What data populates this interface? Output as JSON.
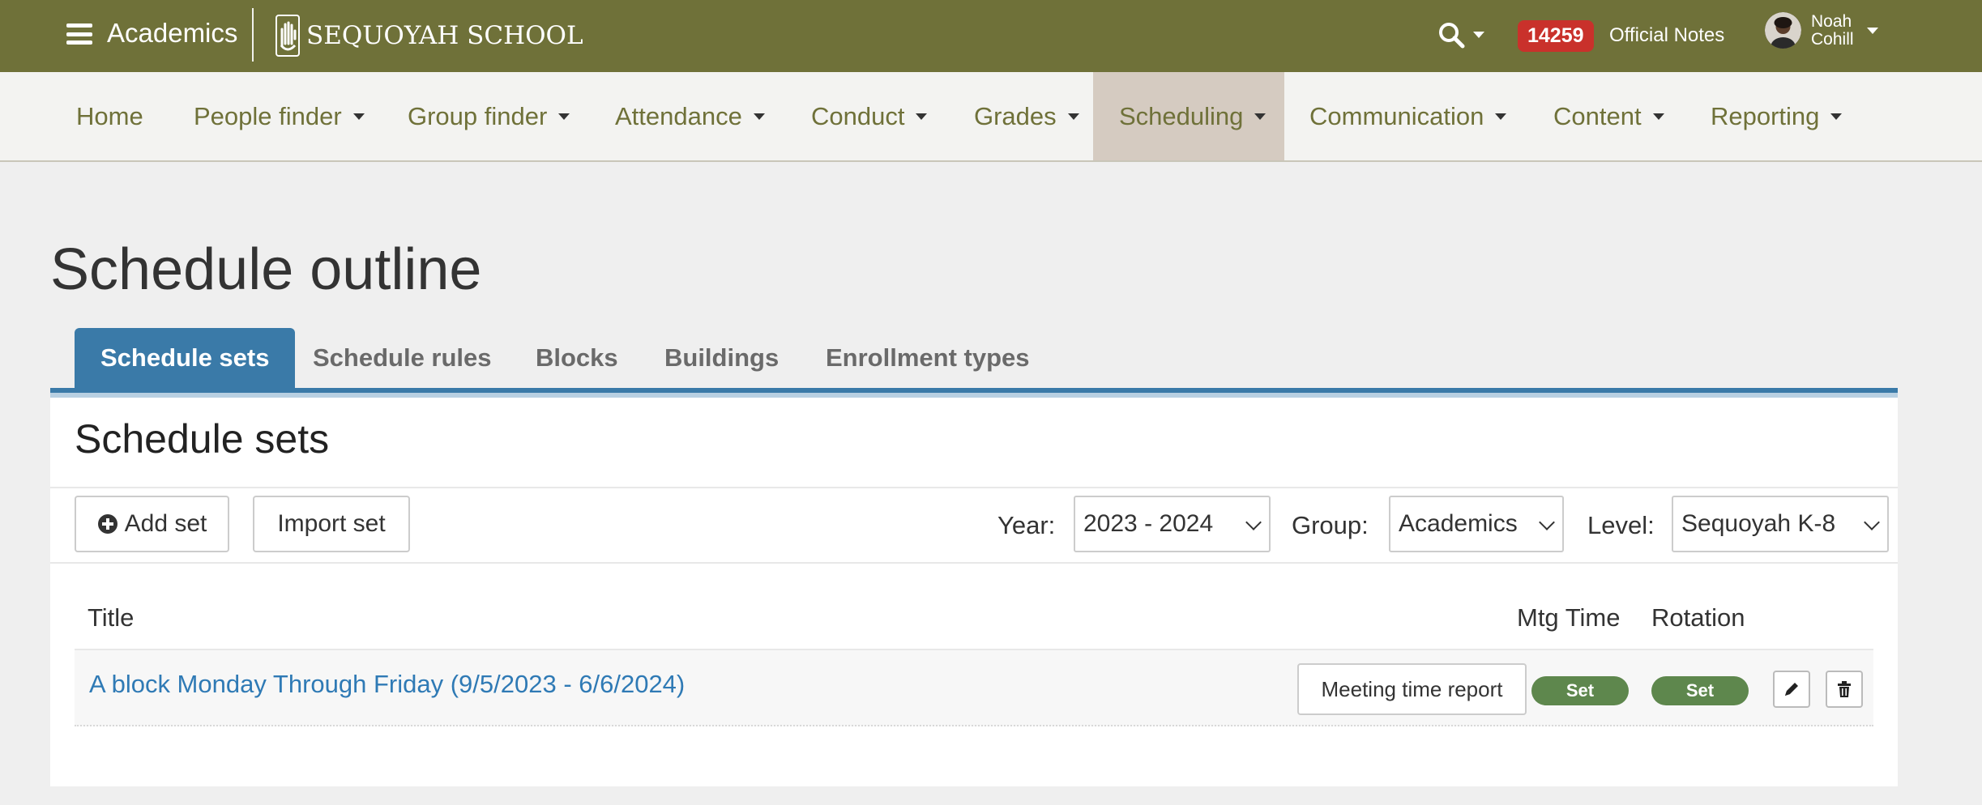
{
  "header": {
    "app_title": "Academics",
    "logo_text": "SEQUOYAH SCHOOL",
    "notes_count": "14259",
    "notes_label": "Official Notes",
    "user_first": "Noah",
    "user_last": "Cohill"
  },
  "nav": {
    "items": [
      {
        "label": "Home"
      },
      {
        "label": "People finder"
      },
      {
        "label": "Group finder"
      },
      {
        "label": "Attendance"
      },
      {
        "label": "Conduct"
      },
      {
        "label": "Grades"
      },
      {
        "label": "Scheduling"
      },
      {
        "label": "Communication"
      },
      {
        "label": "Content"
      },
      {
        "label": "Reporting"
      }
    ],
    "active": "Scheduling"
  },
  "page": {
    "title": "Schedule outline"
  },
  "tabs": [
    {
      "label": "Schedule sets"
    },
    {
      "label": "Schedule rules"
    },
    {
      "label": "Blocks"
    },
    {
      "label": "Buildings"
    },
    {
      "label": "Enrollment types"
    }
  ],
  "panel": {
    "title": "Schedule sets",
    "add_set_label": "Add set",
    "import_set_label": "Import set",
    "filters": {
      "year_label": "Year:",
      "year_value": "2023 - 2024",
      "group_label": "Group:",
      "group_value": "Academics",
      "level_label": "Level:",
      "level_value": "Sequoyah K-8"
    },
    "table": {
      "headers": {
        "title": "Title",
        "mtg_time": "Mtg Time",
        "rotation": "Rotation"
      },
      "rows": [
        {
          "title": "A block Monday Through Friday (9/5/2023 - 6/6/2024)",
          "report_label": "Meeting time report",
          "mtg_time": "Set",
          "rotation": "Set"
        }
      ]
    }
  },
  "colors": {
    "header_bg": "#6f7139",
    "accent_blue": "#3a7aa8",
    "link_blue": "#2f7ab5",
    "badge_red": "#c9312b",
    "pill_green": "#5e874d"
  },
  "icons": {
    "menu": "hamburger-icon",
    "search": "search-icon",
    "add": "plus-circle-icon",
    "edit": "pencil-icon",
    "delete": "trash-icon"
  }
}
